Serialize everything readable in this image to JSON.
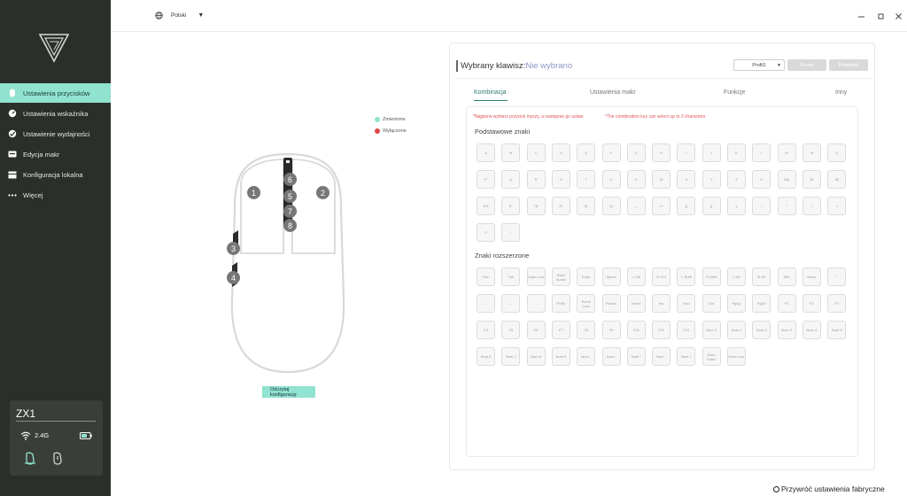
{
  "sidebar": {
    "items": [
      {
        "label": "Ustawienia przycisków",
        "icon": "mouse-icon",
        "active": true
      },
      {
        "label": "Ustawienia wskaźnika",
        "icon": "gauge-icon",
        "active": false
      },
      {
        "label": "Ustawienie wydajności",
        "icon": "performance-icon",
        "active": false
      },
      {
        "label": "Edycja makr",
        "icon": "macro-icon",
        "active": false
      },
      {
        "label": "Konfiguracja lokalna",
        "icon": "storage-icon",
        "active": false
      },
      {
        "label": "Więcej",
        "icon": "more-icon",
        "active": false
      }
    ],
    "device": {
      "name": "ZX1",
      "frequency": "2.4G"
    }
  },
  "header": {
    "language": "Polski"
  },
  "legend": {
    "changed": "Zmienione",
    "disabled": "Wyłączone",
    "changed_color": "#8fe3cf",
    "disabled_color": "#e04848"
  },
  "mouse": {
    "buttons": [
      "1",
      "2",
      "3",
      "4",
      "5",
      "6",
      "7",
      "8"
    ],
    "read_config": "Odczytaj konfigurację"
  },
  "panel": {
    "selected_label": "Wybrany klawisz:",
    "selected_value": "Nie wybrano",
    "profile": "Profil1",
    "reset_btn": "Reset",
    "apply_btn": "Powierdź",
    "tabs": [
      "Kombinacja",
      "Ustawienia makr",
      "Funkcje",
      "Inny"
    ],
    "note1": "*Najpierw wybierz przycisk myszy, a następnie go ustaw",
    "note2": "*The combination key can select up to 3 characters",
    "basic_title": "Podstawowe znaki",
    "basic_keys": [
      "A",
      "B",
      "C",
      "D",
      "E",
      "F",
      "G",
      "H",
      "I",
      "J",
      "K",
      "L",
      "M",
      "N",
      "O",
      "P",
      "Q",
      "R",
      "S",
      "T",
      "U",
      "V",
      "W",
      "X",
      "Y",
      "Z",
      "1!",
      "2@",
      "3#",
      "4$",
      "5%",
      "6^",
      "7&",
      "8*",
      "9(",
      "0)",
      "-_",
      "=+",
      "[{",
      "]}",
      "\\|",
      ";:",
      "'\"",
      ",<",
      ".>",
      "/?",
      "`~"
    ],
    "extended_title": "Znaki rozszerzone",
    "extended_keys": [
      "Esc",
      "Tab",
      "Caps Lock",
      "Back Space",
      "Enter",
      "Space",
      "L-Ctrl",
      "R-Ctrl",
      "L-Shift",
      "R-Shift",
      "L-Alt",
      "R-Alt",
      "Win",
      "Menu",
      "↑",
      "↓",
      "←",
      "→",
      "PrtSc",
      "Scroll Lock",
      "Pause",
      "Home",
      "Ins",
      "End",
      "Del",
      "PgUp",
      "PgDn",
      "F1",
      "F2",
      "F3",
      "F4",
      "F5",
      "F6",
      "F7",
      "F8",
      "F9",
      "F10",
      "F11",
      "F12",
      "Num 0",
      "Num 1",
      "Num 2",
      "Num 3",
      "Num 4",
      "Num 5",
      "Num 6",
      "Num 7",
      "Num 8",
      "Num 9",
      "Num .",
      "Num /",
      "Num *",
      "Num -",
      "Num +",
      "Num Enter",
      "Num Lock"
    ]
  },
  "footer": {
    "reset_factory": "Przywróć ustawienia fabryczne"
  }
}
